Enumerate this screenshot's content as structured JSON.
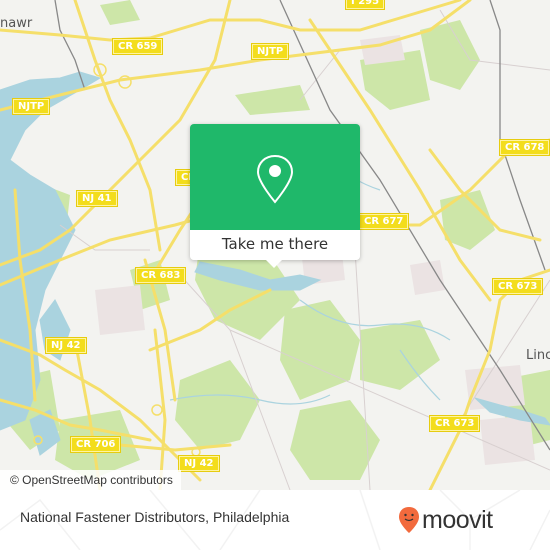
{
  "map": {
    "road_labels": [
      {
        "id": "cr659",
        "text": "CR 659"
      },
      {
        "id": "njtp-top",
        "text": "NJTP"
      },
      {
        "id": "njtp-left",
        "text": "NJTP"
      },
      {
        "id": "i295",
        "text": "I 295"
      },
      {
        "id": "cr678",
        "text": "CR 678"
      },
      {
        "id": "cr-partial",
        "text": "CR"
      },
      {
        "id": "nj41",
        "text": "NJ 41"
      },
      {
        "id": "cr677",
        "text": "CR 677"
      },
      {
        "id": "cr683",
        "text": "CR 683"
      },
      {
        "id": "cr673-east",
        "text": "CR 673"
      },
      {
        "id": "nj42-west",
        "text": "NJ 42"
      },
      {
        "id": "cr673-south",
        "text": "CR 673"
      },
      {
        "id": "cr706",
        "text": "CR 706"
      },
      {
        "id": "nj42-south",
        "text": "NJ 42"
      }
    ],
    "place_labels": [
      {
        "id": "bellmawr",
        "text": "nawr"
      },
      {
        "id": "lindenwold",
        "text": "Linc"
      }
    ],
    "colors": {
      "land": "#f3f3f0",
      "water": "#aad3df",
      "park": "#cde6a8",
      "road_major": "#f5df6a",
      "road_minor": "#d8d0d0",
      "rail": "#888888"
    }
  },
  "popup": {
    "icon": "map-pin-icon",
    "button_label": "Take me there",
    "color": "#1fb86a"
  },
  "attribution": {
    "text": "© OpenStreetMap contributors"
  },
  "footer": {
    "title": "National Fastener Distributors, Philadelphia",
    "logo_text": "moovit",
    "logo_color": "#f26a3d"
  }
}
